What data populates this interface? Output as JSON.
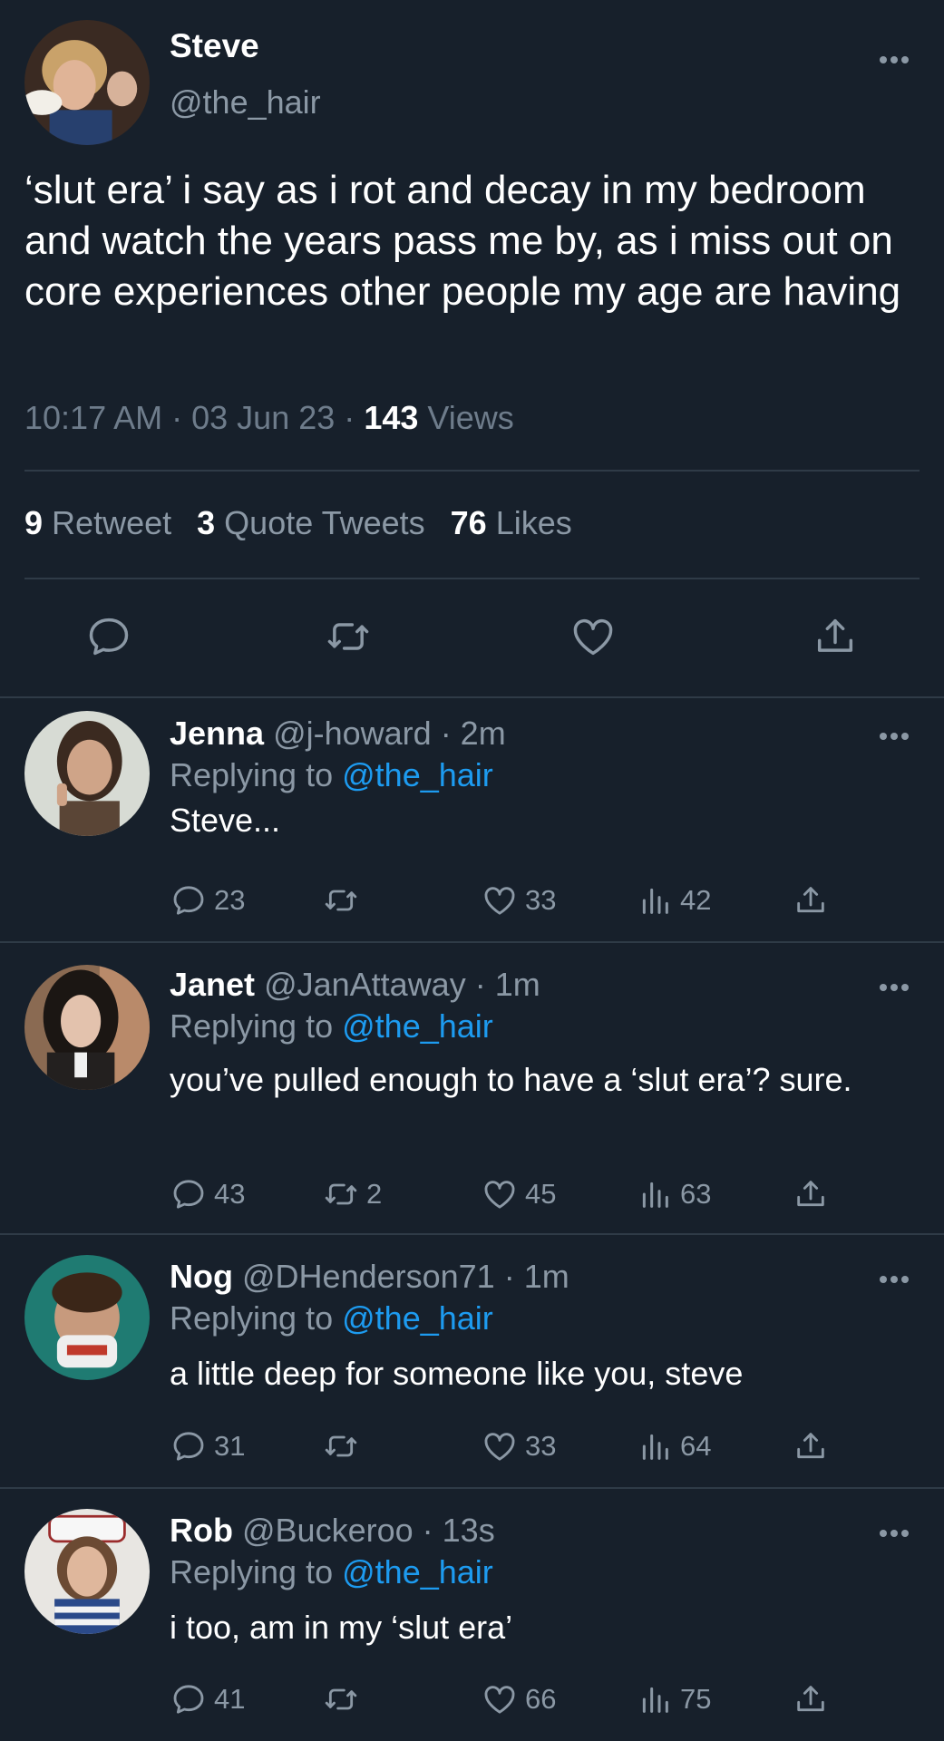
{
  "colors": {
    "background": "#17202b",
    "text": "#ffffff",
    "muted": "#8b98a5",
    "link": "#1d9bf0",
    "divider": "#2f3b47"
  },
  "main_tweet": {
    "name": "Steve",
    "handle": "@the_hair",
    "text": "‘slut era’ i say as i rot and decay in my bedroom and watch the years pass me by, as i miss out on core experiences other people my age are having",
    "time": "10:17 AM",
    "sep1": "·",
    "date": "03 Jun 23",
    "sep2": "·",
    "views_count": "143",
    "views_label": "Views",
    "retweets_count": "9",
    "retweets_label": "Retweet",
    "quotes_count": "3",
    "quotes_label": "Quote Tweets",
    "likes_count": "76",
    "likes_label": "Likes",
    "actions": [
      "reply-icon",
      "retweet-icon",
      "like-icon",
      "share-icon"
    ]
  },
  "replies": [
    {
      "name": "Jenna",
      "handle": "@j-howard",
      "time": "· 2m",
      "replying_label": "Replying to",
      "replying_to": "@the_hair",
      "text": "Steve...",
      "reply_count": "23",
      "retweet_count": "",
      "like_count": "33",
      "views_count": "42"
    },
    {
      "name": "Janet",
      "handle": "@JanAttaway",
      "time": "· 1m",
      "replying_label": "Replying to",
      "replying_to": "@the_hair",
      "text": "you’ve pulled enough to have a ‘slut era’? sure.",
      "reply_count": "43",
      "retweet_count": "2",
      "like_count": "45",
      "views_count": "63"
    },
    {
      "name": "Nog",
      "handle": "@DHenderson71",
      "time": "· 1m",
      "replying_label": "Replying to",
      "replying_to": "@the_hair",
      "text": "a little deep for someone like you, steve",
      "reply_count": "31",
      "retweet_count": "",
      "like_count": "33",
      "views_count": "64"
    },
    {
      "name": "Rob",
      "handle": "@Buckeroo",
      "time": "· 13s",
      "replying_label": "Replying to",
      "replying_to": "@the_hair",
      "text": "i too, am in my ‘slut era’",
      "reply_count": "41",
      "retweet_count": "",
      "like_count": "66",
      "views_count": "75"
    }
  ]
}
